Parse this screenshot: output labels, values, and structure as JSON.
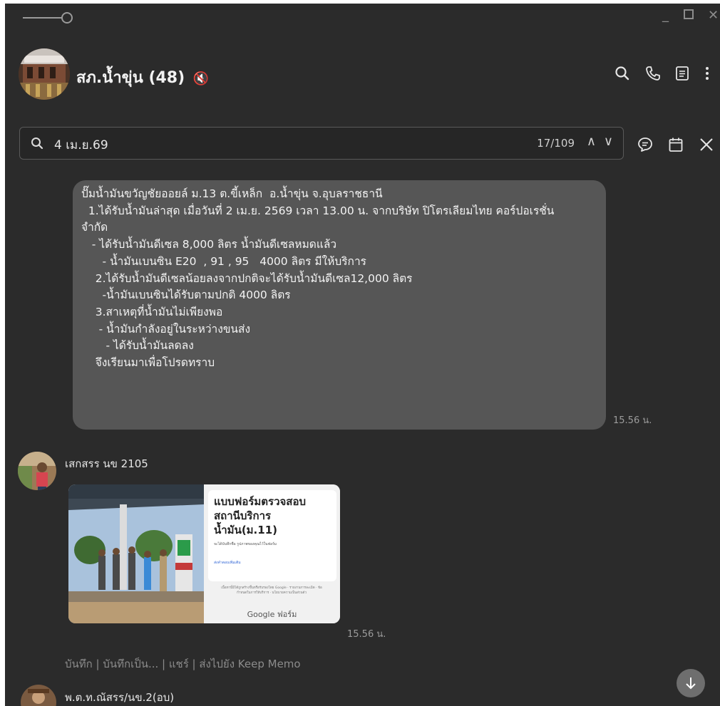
{
  "header": {
    "room_name": "สภ.น้ำขุ่น",
    "member_count": "(48)",
    "muted_icon": "🔇"
  },
  "search": {
    "query": "4 เม.ย.69",
    "result_counter": "17/109",
    "prev_glyph": "∧",
    "next_glyph": "∨"
  },
  "messages": {
    "report": {
      "text": "ปั๊มน้ำมันขวัญชัยออยล์ ม.13 ต.ขี้เหล็ก  อ.น้ำขุ่น จ.อุบลราชธานี\n  1.ได้รับน้ำมันล่าสุด เมื่อวันที่ 2 เม.ย. 2569 เวลา 13.00 น. จากบริษัท ปิโตรเลียมไทย คอร์ปอเรชั่น\nจำกัด\n   - ได้รับน้ำมันดีเซล 8,000 ลิตร น้ำมันดีเซลหมดแล้ว\n      - น้ำมันเบนซิน E20  , 91 , 95   4000 ลิตร มีให้บริการ\n    2.ได้รับน้ำมันดีเซลน้อยลงจากปกติจะได้รับน้ำมันดีเซล12,000 ลิตร\n      -น้ำมันเบนซินได้รับตามปกติ 4000 ลิตร\n    3.สาเหตุที่น้ำมันไม่เพียงพอ\n     - น้ำมันกำลังอยู่ในระหว่างขนส่ง\n       - ได้รับน้ำมันลดลง\n    จึงเรียนมาเพื่อโปรดทราบ",
      "time": "15.56 น."
    },
    "form_share": {
      "sender": "เสกสรร นข 2105",
      "form_title": "แบบฟอร์มตรวจสอบสถานีบริการน้ำมัน(ม.11)",
      "form_desc": "จะได้บันทึกชื่อ รูปภาพของคุณไว้ในฟอร์ม",
      "form_link": "ส่งคำตอบเพิ่มเติม",
      "form_note": "เนื้อหานี้มิได้ถูกสร้างขึ้นหรือรับรองโดย Google · รายงานการละเมิด · ข้อกำหนดในการให้บริการ · นโยบายความเป็นส่วนตัว",
      "brand": "Google ฟอร์ม",
      "time": "15.56 น."
    },
    "actions": "บันทึก | บันทึกเป็น... | แชร์ | ส่งไปยัง Keep Memo",
    "next_sender": "พ.ต.ท.ณัสรร/นข.2(อบ)"
  },
  "colors": {
    "window_bg": "#2b2b2b",
    "bubble_bg": "#565656",
    "timestamp": "#9c9c9c"
  },
  "icons": [
    "pin-icon",
    "minimize-icon",
    "maximize-icon",
    "close-icon",
    "search-icon",
    "phone-icon",
    "notes-icon",
    "more-icon",
    "chat-bubble-icon",
    "calendar-icon",
    "close-search-icon",
    "scroll-down-icon"
  ]
}
